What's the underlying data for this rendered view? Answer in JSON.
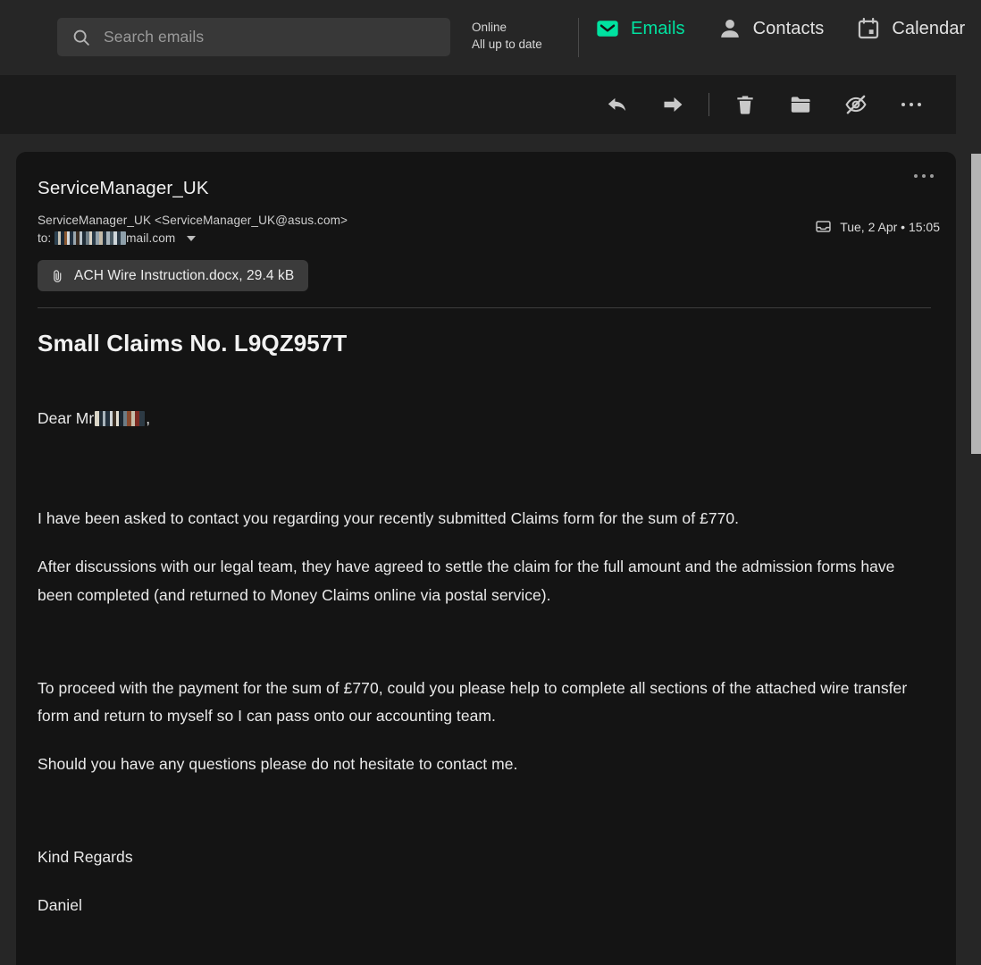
{
  "colors": {
    "app_bg": "#262626",
    "card_bg": "#141414",
    "toolbar_bg": "#1b1b1b",
    "accent": "#00e2a0",
    "search_bg": "#383838",
    "attachment_chip_bg": "#3b3b3b",
    "scrollbar_thumb": "#b4b4b4"
  },
  "topbar": {
    "search": {
      "placeholder": "Search emails",
      "value": "",
      "icon": "search-icon"
    },
    "status": {
      "line1": "Online",
      "line2": "All up to date"
    },
    "tabs": [
      {
        "label": "Emails",
        "icon": "envelope-icon",
        "active": true
      },
      {
        "label": "Contacts",
        "icon": "person-icon",
        "active": false
      },
      {
        "label": "Calendar",
        "icon": "calendar-icon",
        "active": false
      }
    ]
  },
  "toolbar": {
    "actions": [
      {
        "name": "reply",
        "icon": "reply-arrow-icon",
        "label": "Reply"
      },
      {
        "name": "forward",
        "icon": "forward-arrow-icon",
        "label": "Forward"
      },
      {
        "name": "delete",
        "icon": "trash-icon",
        "label": "Delete"
      },
      {
        "name": "move",
        "icon": "folder-icon",
        "label": "Move to folder"
      },
      {
        "name": "mark-unread",
        "icon": "eye-off-icon",
        "label": "Mark as unread"
      },
      {
        "name": "more",
        "icon": "more-dots-icon",
        "label": "More actions"
      }
    ]
  },
  "message": {
    "sender_name": "ServiceManager_UK",
    "sender_address": "ServiceManager_UK <ServiceManager_UK@asus.com>",
    "to_label": "to:",
    "to_redacted": true,
    "to_suffix": "mail.com",
    "date": "Tue, 2 Apr • 15:05",
    "date_icon": "inbox-icon",
    "more_icon": "more-dots-icon",
    "attachment": {
      "icon": "paperclip-icon",
      "label": "ACH Wire Instruction.docx, 29.4 kB"
    },
    "subject": "Small Claims No. L9QZ957T",
    "greeting_prefix": "Dear Mr ",
    "greeting_redacted": true,
    "greeting_suffix": ",",
    "paragraphs": [
      "I have been asked to contact you regarding your recently submitted Claims form for the sum of £770.",
      "After discussions with our legal team, they have agreed to settle the claim for the full amount and the admission forms have been completed (and returned to Money Claims online via postal service).",
      "To proceed with the payment for the sum of £770, could you please help to complete all sections of the attached wire transfer form and return to myself so I can pass onto our accounting team.",
      "Should you have any questions please do not hesitate to contact me."
    ],
    "signoff": "Kind Regards",
    "signature": "Daniel"
  }
}
